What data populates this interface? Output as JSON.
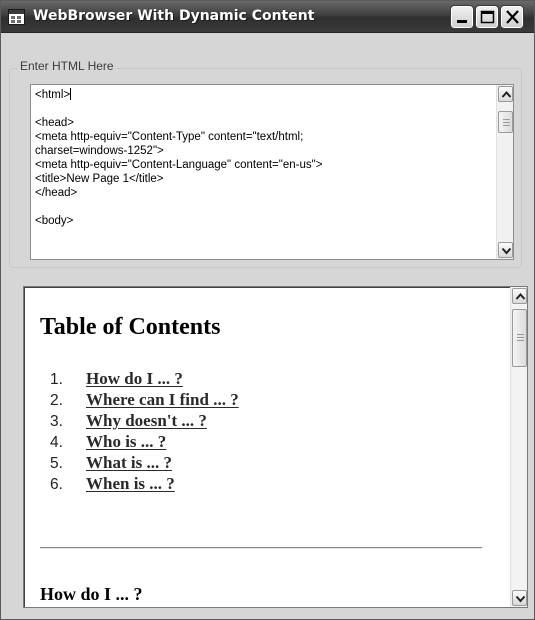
{
  "window": {
    "title": "WebBrowser With Dynamic Content",
    "icon": "app-window-icon",
    "controls": [
      "minimize-icon",
      "maximize-icon",
      "close-icon"
    ]
  },
  "editor_group": {
    "label": "Enter HTML Here"
  },
  "editor": {
    "first_line": "<html>",
    "rest": "\n\n<head>\n<meta http-equiv=\"Content-Type\" content=\"text/html;\ncharset=windows-1252\">\n<meta http-equiv=\"Content-Language\" content=\"en-us\">\n<title>New Page 1</title>\n</head>\n\n<body>"
  },
  "browser": {
    "heading": "Table of Contents",
    "toc": [
      {
        "num": "1.",
        "label": "How do I ... ?"
      },
      {
        "num": "2.",
        "label": "Where can I find ... ?"
      },
      {
        "num": "3.",
        "label": "Why doesn't ... ?"
      },
      {
        "num": "4.",
        "label": "Who is ... ?"
      },
      {
        "num": "5.",
        "label": "What is ... ?"
      },
      {
        "num": "6.",
        "label": "When is ... ?"
      }
    ],
    "section_heading": "How do I ... ?"
  },
  "colors": {
    "titlebar": "#3e3e3e",
    "window_bg": "#d6d6d6",
    "link": "#2a2a2a"
  }
}
